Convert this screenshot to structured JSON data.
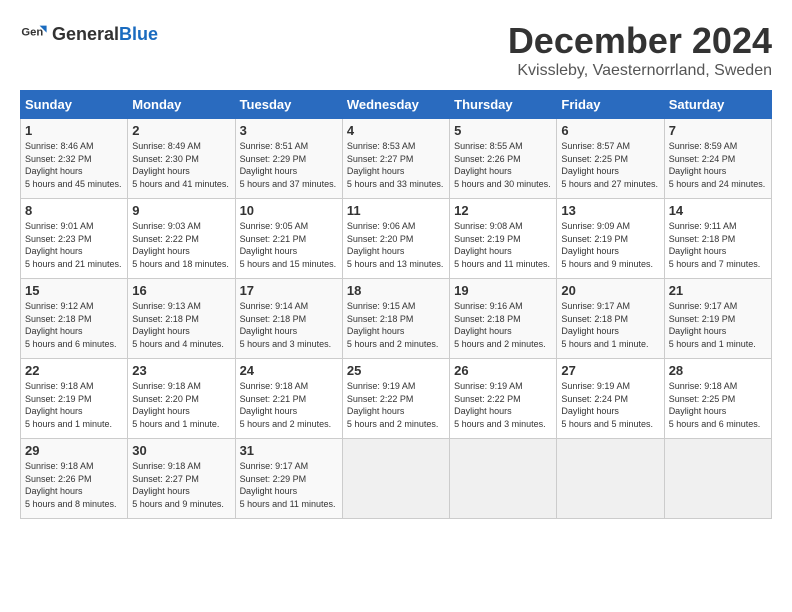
{
  "logo": {
    "general": "General",
    "blue": "Blue"
  },
  "title": "December 2024",
  "location": "Kvissleby, Vaesternorrland, Sweden",
  "days_of_week": [
    "Sunday",
    "Monday",
    "Tuesday",
    "Wednesday",
    "Thursday",
    "Friday",
    "Saturday"
  ],
  "weeks": [
    [
      {
        "day": "1",
        "sunrise": "8:46 AM",
        "sunset": "2:32 PM",
        "daylight": "5 hours and 45 minutes."
      },
      {
        "day": "2",
        "sunrise": "8:49 AM",
        "sunset": "2:30 PM",
        "daylight": "5 hours and 41 minutes."
      },
      {
        "day": "3",
        "sunrise": "8:51 AM",
        "sunset": "2:29 PM",
        "daylight": "5 hours and 37 minutes."
      },
      {
        "day": "4",
        "sunrise": "8:53 AM",
        "sunset": "2:27 PM",
        "daylight": "5 hours and 33 minutes."
      },
      {
        "day": "5",
        "sunrise": "8:55 AM",
        "sunset": "2:26 PM",
        "daylight": "5 hours and 30 minutes."
      },
      {
        "day": "6",
        "sunrise": "8:57 AM",
        "sunset": "2:25 PM",
        "daylight": "5 hours and 27 minutes."
      },
      {
        "day": "7",
        "sunrise": "8:59 AM",
        "sunset": "2:24 PM",
        "daylight": "5 hours and 24 minutes."
      }
    ],
    [
      {
        "day": "8",
        "sunrise": "9:01 AM",
        "sunset": "2:23 PM",
        "daylight": "5 hours and 21 minutes."
      },
      {
        "day": "9",
        "sunrise": "9:03 AM",
        "sunset": "2:22 PM",
        "daylight": "5 hours and 18 minutes."
      },
      {
        "day": "10",
        "sunrise": "9:05 AM",
        "sunset": "2:21 PM",
        "daylight": "5 hours and 15 minutes."
      },
      {
        "day": "11",
        "sunrise": "9:06 AM",
        "sunset": "2:20 PM",
        "daylight": "5 hours and 13 minutes."
      },
      {
        "day": "12",
        "sunrise": "9:08 AM",
        "sunset": "2:19 PM",
        "daylight": "5 hours and 11 minutes."
      },
      {
        "day": "13",
        "sunrise": "9:09 AM",
        "sunset": "2:19 PM",
        "daylight": "5 hours and 9 minutes."
      },
      {
        "day": "14",
        "sunrise": "9:11 AM",
        "sunset": "2:18 PM",
        "daylight": "5 hours and 7 minutes."
      }
    ],
    [
      {
        "day": "15",
        "sunrise": "9:12 AM",
        "sunset": "2:18 PM",
        "daylight": "5 hours and 6 minutes."
      },
      {
        "day": "16",
        "sunrise": "9:13 AM",
        "sunset": "2:18 PM",
        "daylight": "5 hours and 4 minutes."
      },
      {
        "day": "17",
        "sunrise": "9:14 AM",
        "sunset": "2:18 PM",
        "daylight": "5 hours and 3 minutes."
      },
      {
        "day": "18",
        "sunrise": "9:15 AM",
        "sunset": "2:18 PM",
        "daylight": "5 hours and 2 minutes."
      },
      {
        "day": "19",
        "sunrise": "9:16 AM",
        "sunset": "2:18 PM",
        "daylight": "5 hours and 2 minutes."
      },
      {
        "day": "20",
        "sunrise": "9:17 AM",
        "sunset": "2:18 PM",
        "daylight": "5 hours and 1 minute."
      },
      {
        "day": "21",
        "sunrise": "9:17 AM",
        "sunset": "2:19 PM",
        "daylight": "5 hours and 1 minute."
      }
    ],
    [
      {
        "day": "22",
        "sunrise": "9:18 AM",
        "sunset": "2:19 PM",
        "daylight": "5 hours and 1 minute."
      },
      {
        "day": "23",
        "sunrise": "9:18 AM",
        "sunset": "2:20 PM",
        "daylight": "5 hours and 1 minute."
      },
      {
        "day": "24",
        "sunrise": "9:18 AM",
        "sunset": "2:21 PM",
        "daylight": "5 hours and 2 minutes."
      },
      {
        "day": "25",
        "sunrise": "9:19 AM",
        "sunset": "2:22 PM",
        "daylight": "5 hours and 2 minutes."
      },
      {
        "day": "26",
        "sunrise": "9:19 AM",
        "sunset": "2:22 PM",
        "daylight": "5 hours and 3 minutes."
      },
      {
        "day": "27",
        "sunrise": "9:19 AM",
        "sunset": "2:24 PM",
        "daylight": "5 hours and 5 minutes."
      },
      {
        "day": "28",
        "sunrise": "9:18 AM",
        "sunset": "2:25 PM",
        "daylight": "5 hours and 6 minutes."
      }
    ],
    [
      {
        "day": "29",
        "sunrise": "9:18 AM",
        "sunset": "2:26 PM",
        "daylight": "5 hours and 8 minutes."
      },
      {
        "day": "30",
        "sunrise": "9:18 AM",
        "sunset": "2:27 PM",
        "daylight": "5 hours and 9 minutes."
      },
      {
        "day": "31",
        "sunrise": "9:17 AM",
        "sunset": "2:29 PM",
        "daylight": "5 hours and 11 minutes."
      },
      null,
      null,
      null,
      null
    ]
  ]
}
